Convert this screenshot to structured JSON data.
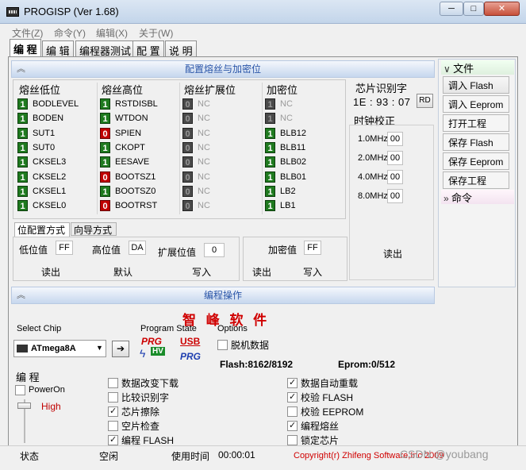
{
  "window": {
    "title": "PROGISP (Ver 1.68)",
    "minimize": "─",
    "maximize": "□",
    "close": "✕"
  },
  "menu": [
    "文件(Z)",
    "命令(Y)",
    "编辑(X)",
    "关于(W)"
  ],
  "tabs": [
    "编 程",
    "编 辑",
    "编程器测试",
    "配 置",
    "说 明"
  ],
  "fuse_section": {
    "header": "配置熔丝与加密位",
    "columns": [
      {
        "title": "熔丝低位",
        "rows": [
          {
            "bit": "1",
            "name": "BODLEVEL",
            "state": "one"
          },
          {
            "bit": "1",
            "name": "BODEN",
            "state": "one"
          },
          {
            "bit": "1",
            "name": "SUT1",
            "state": "one"
          },
          {
            "bit": "1",
            "name": "SUT0",
            "state": "one"
          },
          {
            "bit": "1",
            "name": "CKSEL3",
            "state": "one"
          },
          {
            "bit": "1",
            "name": "CKSEL2",
            "state": "one"
          },
          {
            "bit": "1",
            "name": "CKSEL1",
            "state": "one"
          },
          {
            "bit": "1",
            "name": "CKSEL0",
            "state": "one"
          }
        ]
      },
      {
        "title": "熔丝高位",
        "rows": [
          {
            "bit": "1",
            "name": "RSTDISBL",
            "state": "one"
          },
          {
            "bit": "1",
            "name": "WTDON",
            "state": "one"
          },
          {
            "bit": "0",
            "name": "SPIEN",
            "state": "zero"
          },
          {
            "bit": "1",
            "name": "CKOPT",
            "state": "one"
          },
          {
            "bit": "1",
            "name": "EESAVE",
            "state": "one"
          },
          {
            "bit": "0",
            "name": "BOOTSZ1",
            "state": "zero"
          },
          {
            "bit": "1",
            "name": "BOOTSZ0",
            "state": "one"
          },
          {
            "bit": "0",
            "name": "BOOTRST",
            "state": "zero"
          }
        ]
      },
      {
        "title": "熔丝扩展位",
        "rows": [
          {
            "bit": "0",
            "name": "NC",
            "state": "dis"
          },
          {
            "bit": "0",
            "name": "NC",
            "state": "dis"
          },
          {
            "bit": "0",
            "name": "NC",
            "state": "dis"
          },
          {
            "bit": "0",
            "name": "NC",
            "state": "dis"
          },
          {
            "bit": "0",
            "name": "NC",
            "state": "dis"
          },
          {
            "bit": "0",
            "name": "NC",
            "state": "dis"
          },
          {
            "bit": "0",
            "name": "NC",
            "state": "dis"
          },
          {
            "bit": "0",
            "name": "NC",
            "state": "dis"
          }
        ]
      },
      {
        "title": "加密位",
        "rows": [
          {
            "bit": "1",
            "name": "NC",
            "state": "dis"
          },
          {
            "bit": "1",
            "name": "NC",
            "state": "dis"
          },
          {
            "bit": "1",
            "name": "BLB12",
            "state": "one"
          },
          {
            "bit": "1",
            "name": "BLB11",
            "state": "one"
          },
          {
            "bit": "1",
            "name": "BLB02",
            "state": "one"
          },
          {
            "bit": "1",
            "name": "BLB01",
            "state": "one"
          },
          {
            "bit": "1",
            "name": "LB2",
            "state": "one"
          },
          {
            "bit": "1",
            "name": "LB1",
            "state": "one"
          }
        ]
      }
    ],
    "subtabs": [
      "位配置方式",
      "向导方式"
    ],
    "low_label": "低位值",
    "low_value": "FF",
    "high_label": "高位值",
    "high_value": "DA",
    "ext_label": "扩展位值",
    "ext_value": "0",
    "lock_label": "加密值",
    "lock_value": "FF",
    "read": "读出",
    "default": "默认",
    "write": "写入",
    "read2": "读出",
    "write2": "写入",
    "chip_id_title": "芯片识别字",
    "chip_id": "1E : 93 : 07",
    "rd": "RD",
    "clock_title": "时钟校正",
    "clocks": [
      {
        "label": "1.0MHz",
        "value": "00"
      },
      {
        "label": "2.0MHz",
        "value": "00"
      },
      {
        "label": "4.0MHz",
        "value": "00"
      },
      {
        "label": "8.0MHz",
        "value": "00"
      }
    ],
    "read3": "读出"
  },
  "right_panel": {
    "file_header": "文件",
    "buttons": [
      "调入 Flash",
      "调入 Eeprom",
      "打开工程",
      "保存 Flash",
      "保存 Eeprom",
      "保存工程"
    ],
    "cmd_header": "命令"
  },
  "prog_section": {
    "header": "编程操作",
    "brand": "智 峰 软 件",
    "select_chip_label": "Select Chip",
    "chip": "ATmega8A",
    "go": "➔",
    "program_state_label": "Program State",
    "prg": "PRG",
    "hv": "HV",
    "usb": "USB",
    "options_label": "Options",
    "offline": "脱机数据",
    "flash_info": "Flash:8162/8192",
    "eeprom_info": "Eprom:0/512",
    "prog_group": "编 程",
    "poweron": "PowerOn",
    "level": "High",
    "checks_left": [
      {
        "label": "数据改变下载",
        "on": false
      },
      {
        "label": "比较识别字",
        "on": false
      },
      {
        "label": "芯片擦除",
        "on": true
      },
      {
        "label": "空片检查",
        "on": false
      },
      {
        "label": "编程 FLASH",
        "on": true
      }
    ],
    "checks_right": [
      {
        "label": "数据自动重载",
        "on": true
      },
      {
        "label": "校验 FLASH",
        "on": true
      },
      {
        "label": "校验 EEPROM",
        "on": false
      },
      {
        "label": "编程熔丝",
        "on": true
      },
      {
        "label": "锁定芯片",
        "on": false
      }
    ]
  },
  "status": {
    "state_label": "状态",
    "state": "空闲",
    "time_label": "使用时间",
    "time": "00:00:01",
    "copyright": "Copyright(r) Zhifeng Software,Inc 2009",
    "watermark": "CSDN @youbang"
  },
  "colors": {
    "accent": "#2a55a8",
    "brand": "#d00000",
    "bit_on": "#1f7a1f",
    "bit_off": "#c00000"
  }
}
